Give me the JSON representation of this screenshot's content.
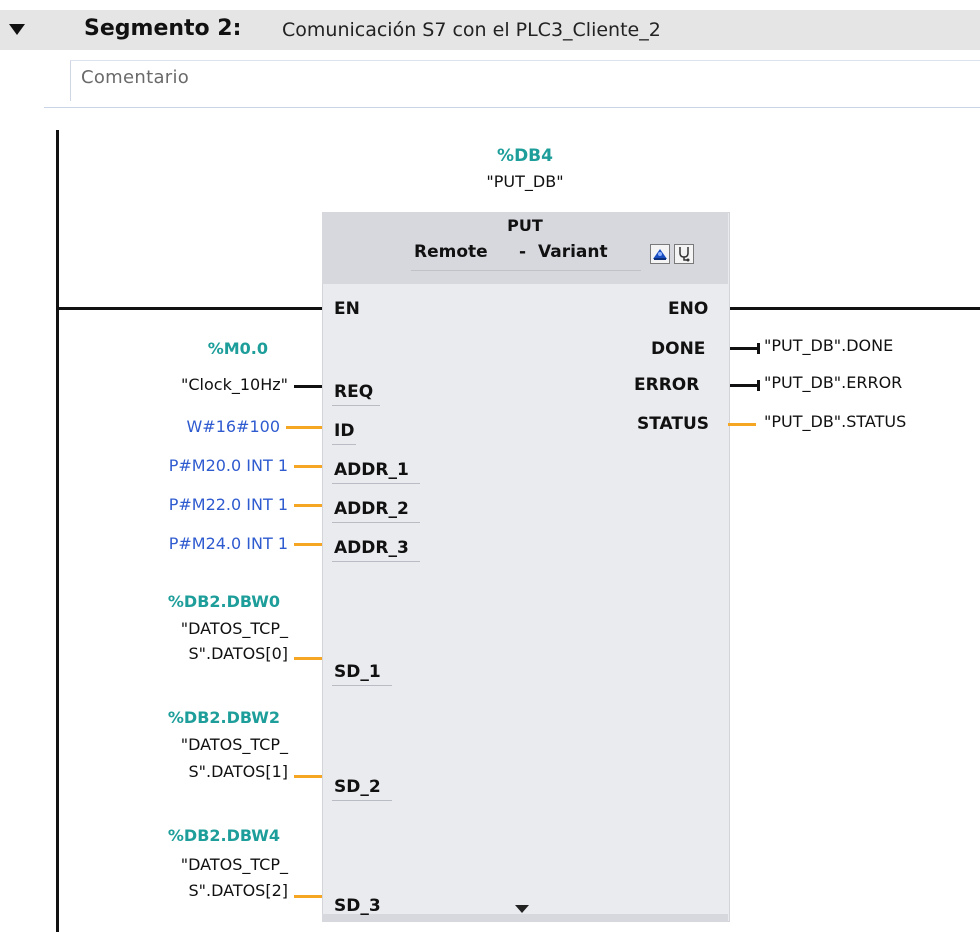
{
  "segment": {
    "title": "Segmento 2:",
    "description": "Comunicación S7 con el PLC3_Cliente_2",
    "comment": "Comentario"
  },
  "instance": {
    "address": "%DB4",
    "symbol": "\"PUT_DB\""
  },
  "block": {
    "name": "PUT",
    "remote_label": "Remote",
    "dash": "-",
    "variant_label": "Variant",
    "icons": [
      "connection-config-icon",
      "diagnostics-icon"
    ]
  },
  "inputs": {
    "en": "EN",
    "req": "REQ",
    "id": "ID",
    "addr_1": "ADDR_1",
    "addr_2": "ADDR_2",
    "addr_3": "ADDR_3",
    "sd_1": "SD_1",
    "sd_2": "SD_2",
    "sd_3": "SD_3"
  },
  "outputs": {
    "eno": "ENO",
    "done": "DONE",
    "error": "ERROR",
    "status": "STATUS"
  },
  "params": {
    "req_address": "%M0.0",
    "req_symbol": "\"Clock_10Hz\"",
    "id_value": "W#16#100",
    "addr_1_value": "P#M20.0 INT 1",
    "addr_2_value": "P#M22.0 INT 1",
    "addr_3_value": "P#M24.0 INT 1",
    "sd_1_address": "%DB2.DBW0",
    "sd_1_symbol_line1": "\"DATOS_TCP_",
    "sd_1_symbol_line2": "S\".DATOS[0]",
    "sd_2_address": "%DB2.DBW2",
    "sd_2_symbol_line1": "\"DATOS_TCP_",
    "sd_2_symbol_line2": "S\".DATOS[1]",
    "sd_3_address": "%DB2.DBW4",
    "sd_3_symbol_line1": "\"DATOS_TCP_",
    "sd_3_symbol_line2": "S\".DATOS[2]",
    "done_target": "\"PUT_DB\".DONE",
    "error_target": "\"PUT_DB\".ERROR",
    "status_target": "\"PUT_DB\".STATUS"
  },
  "colors": {
    "address_teal": "#1e9e9a",
    "constant_blue": "#2f5bd0",
    "wire_orange": "#f5a623",
    "block_body": "#eaebef",
    "block_header": "#d6d8de"
  }
}
